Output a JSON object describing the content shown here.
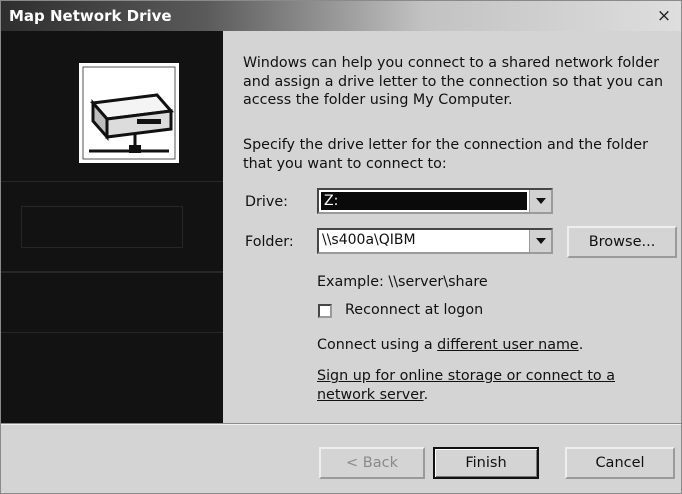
{
  "window": {
    "title": "Map Network Drive",
    "close_glyph": "×"
  },
  "intro_text": "Windows can help you connect to a shared network folder and assign a drive letter to the connection so that you can access the folder using My Computer.",
  "instruction_text": "Specify the drive letter for the connection and the folder that you want to connect to:",
  "drive": {
    "label": "Drive:",
    "value": "Z:"
  },
  "folder": {
    "label": "Folder:",
    "value": "\\\\s400a\\QIBM",
    "browse_label": "Browse..."
  },
  "example_text": "Example: \\\\server\\share",
  "reconnect": {
    "label": "Reconnect at logon",
    "checked": false
  },
  "connect_using": {
    "prefix": "Connect using a ",
    "link": "different user name",
    "suffix": "."
  },
  "signup": {
    "line1": "Sign up for online storage or connect to a",
    "line2_link": "network server",
    "suffix": "."
  },
  "buttons": {
    "back": "< Back",
    "finish": "Finish",
    "cancel": "Cancel"
  },
  "icons": {
    "close": "close-icon",
    "drive": "network-drive-icon",
    "dropdown": "chevron-down-icon"
  }
}
